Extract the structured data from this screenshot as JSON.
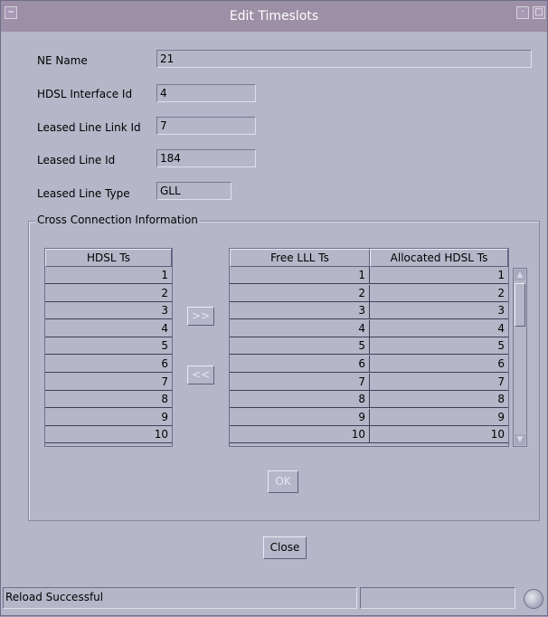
{
  "window": {
    "title": "Edit Timeslots"
  },
  "fields": {
    "ne_name": {
      "label": "NE Name",
      "value": "21"
    },
    "hdsl_interface_id": {
      "label": "HDSL Interface Id",
      "value": "4"
    },
    "leased_line_link_id": {
      "label": "Leased Line Link Id",
      "value": "7"
    },
    "leased_line_id": {
      "label": "Leased Line Id",
      "value": "184"
    },
    "leased_line_type": {
      "label": "Leased Line Type",
      "value": "GLL"
    }
  },
  "cross_connection": {
    "group_label": "Cross Connection Information",
    "hdsl_table": {
      "header": "HDSL Ts",
      "rows": [
        "1",
        "2",
        "3",
        "4",
        "5",
        "6",
        "7",
        "8",
        "9",
        "10"
      ]
    },
    "right_table": {
      "headers": [
        "Free LLL Ts",
        "Allocated HDSL Ts"
      ],
      "rows": [
        [
          "1",
          "1"
        ],
        [
          "2",
          "2"
        ],
        [
          "3",
          "3"
        ],
        [
          "4",
          "4"
        ],
        [
          "5",
          "5"
        ],
        [
          "6",
          "6"
        ],
        [
          "7",
          "7"
        ],
        [
          "8",
          "8"
        ],
        [
          "9",
          "9"
        ],
        [
          "10",
          "10"
        ]
      ]
    },
    "add_button": ">>",
    "remove_button": "<<",
    "ok_button": "OK"
  },
  "close_button": "Close",
  "status": {
    "message": "Reload Successful"
  }
}
